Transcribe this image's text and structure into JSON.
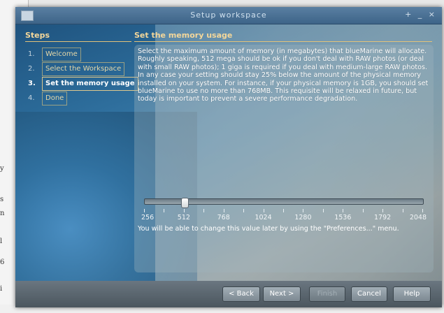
{
  "window": {
    "title": "Setup workspace",
    "controls": [
      "+",
      "_",
      "×"
    ]
  },
  "steps": {
    "heading": "Steps",
    "items": [
      {
        "num": "1.",
        "label": "Welcome",
        "active": false
      },
      {
        "num": "2.",
        "label": "Select the Workspace",
        "active": false
      },
      {
        "num": "3.",
        "label": "Set the memory usage",
        "active": true
      },
      {
        "num": "4.",
        "label": "Done",
        "active": false
      }
    ]
  },
  "content": {
    "heading": "Set the memory usage",
    "paragraph1": "Select the maximum amount of memory (in megabytes) that blueMarine will allocate. Roughly speaking, 512 mega should be ok if you don't deal with RAW photos (or deal with small RAW photos); 1 giga is required if you deal with medium-large RAW photos.",
    "paragraph2": "In any case your setting should stay 25% below the amount of the physical memory installed on your system. For instance, if your physical memory is 1GB, you should set blueMarine to use no more than 768MB. This requisite will be relaxed in future, but today is important to prevent a severe performance degradation.",
    "note": "You will be able to change this value later by using the \"Preferences...\" menu."
  },
  "slider": {
    "min": 256,
    "max": 2048,
    "value": 512,
    "tick_labels": [
      "256",
      "512",
      "768",
      "1024",
      "1280",
      "1536",
      "1792",
      "2048"
    ]
  },
  "buttons": {
    "back": "< Back",
    "next": "Next >",
    "finish": "Finish",
    "cancel": "Cancel",
    "help": "Help"
  },
  "background": {
    "fragments": [
      "y",
      "s",
      "n",
      "l",
      "6",
      "i"
    ]
  }
}
